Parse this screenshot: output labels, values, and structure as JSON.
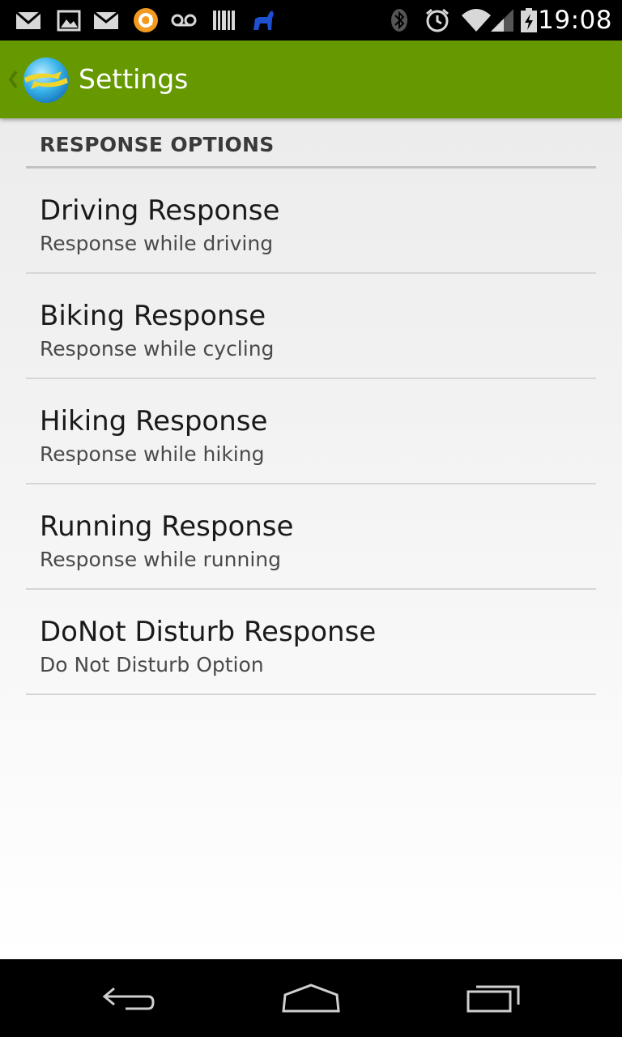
{
  "status_bar": {
    "time": "19:08",
    "left_icons": [
      "gmail-icon",
      "gallery-icon",
      "email-icon",
      "app-circle-icon",
      "voicemail-icon",
      "barcode-icon",
      "cat-icon"
    ],
    "right_icons": [
      "bluetooth-icon",
      "alarm-icon",
      "wifi-icon",
      "signal-icon",
      "battery-icon"
    ]
  },
  "action_bar": {
    "title": "Settings",
    "background_color": "#669900"
  },
  "category": {
    "title": "RESPONSE OPTIONS"
  },
  "preferences": [
    {
      "title": "Driving Response",
      "summary": "Response while driving"
    },
    {
      "title": "Biking Response",
      "summary": "Response while cycling"
    },
    {
      "title": "Hiking Response",
      "summary": "Response while hiking"
    },
    {
      "title": "Running Response",
      "summary": "Response while running"
    },
    {
      "title": "DoNot Disturb Response",
      "summary": "Do Not Disturb Option"
    }
  ],
  "nav_bar": {
    "buttons": [
      "back-icon",
      "home-icon",
      "recents-icon"
    ]
  }
}
